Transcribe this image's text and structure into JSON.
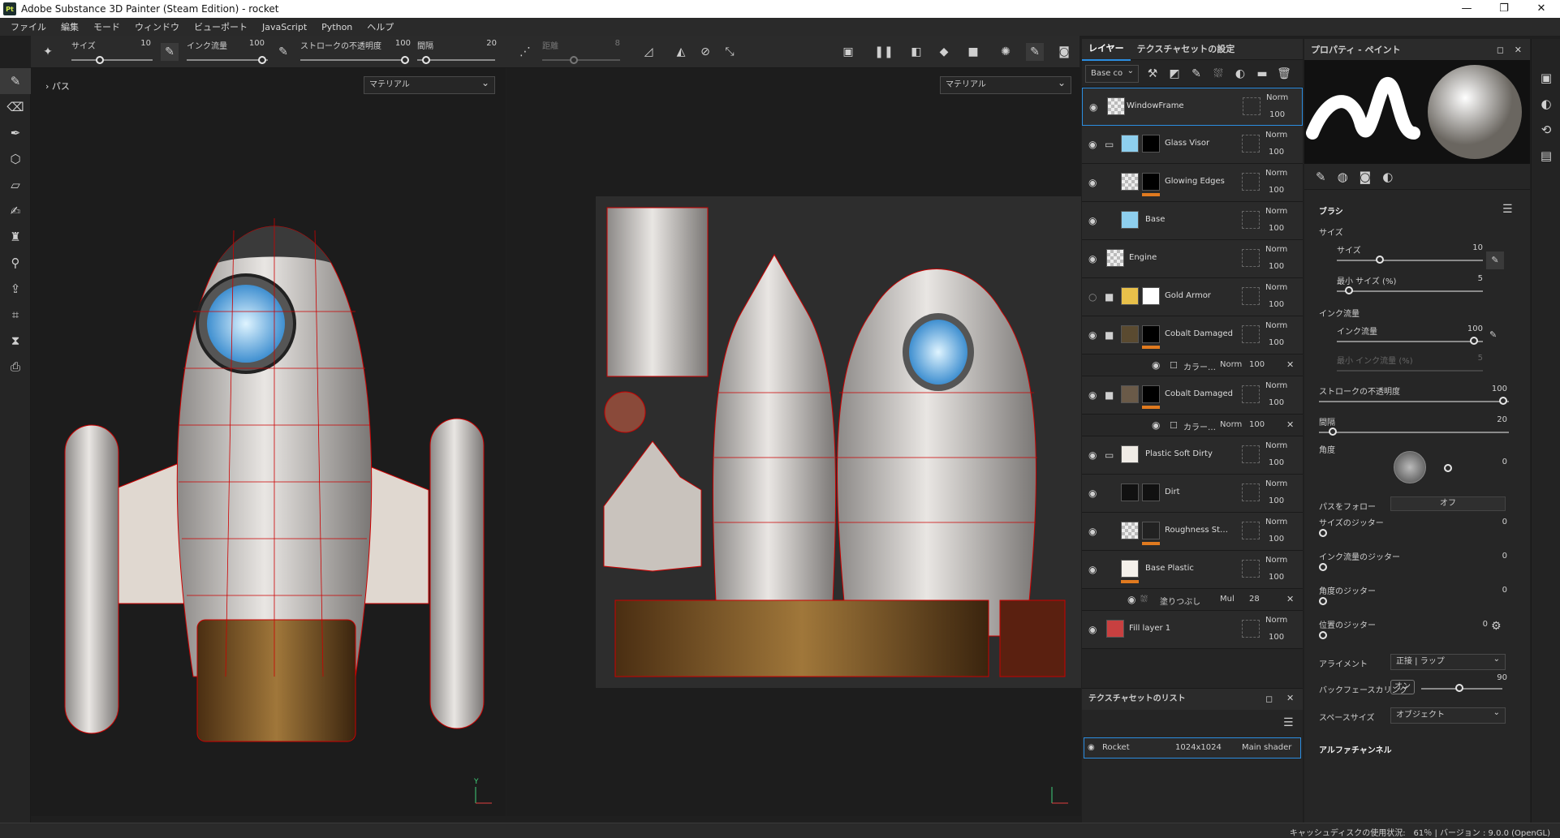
{
  "window": {
    "title": "Adobe Substance 3D Painter (Steam Edition) - rocket",
    "logo": "Pt",
    "controls": [
      "—",
      "❐",
      "✕"
    ]
  },
  "menu": [
    "ファイル",
    "編集",
    "モード",
    "ウィンドウ",
    "ビューポート",
    "JavaScript",
    "Python",
    "ヘルプ"
  ],
  "toolbar": {
    "size_label": "サイズ",
    "size_value": "10",
    "flow_label": "インク流量",
    "flow_value": "100",
    "opacity_label": "ストロークの不透明度",
    "opacity_value": "100",
    "spacing_label": "間隔",
    "spacing_value": "20",
    "distance_label": "距離",
    "distance_value": "8"
  },
  "viewport3d": {
    "path_label": "パス",
    "channel": "マテリアル"
  },
  "viewport2d": {
    "channel": "マテリアル"
  },
  "layers_panel": {
    "tab_layers": "レイヤー",
    "tab_texset": "テクスチャセットの設定",
    "channel_select": "Base co",
    "layers": [
      {
        "name": "WindowFrame",
        "blend": "Norm",
        "opacity": "100",
        "selected": true,
        "folder": false,
        "thumb": "chk",
        "mask": ""
      },
      {
        "name": "Glass Visor",
        "blend": "Norm",
        "opacity": "100",
        "folder": true,
        "thumb": "#8ecfee",
        "mask": "#000"
      },
      {
        "name": "Glowing Edges",
        "blend": "Norm",
        "opacity": "100",
        "folder": false,
        "thumb": "chk",
        "mask": "#000"
      },
      {
        "name": "Base",
        "blend": "Norm",
        "opacity": "100",
        "folder": false,
        "thumb": "#8ecfee",
        "mask": ""
      },
      {
        "name": "Engine",
        "blend": "Norm",
        "opacity": "100",
        "folder": false,
        "thumb": "chk",
        "mask": ""
      },
      {
        "name": "Gold Armor",
        "blend": "Norm",
        "opacity": "100",
        "folder": true,
        "thumb": "#e8c04a",
        "mask": "#fff"
      },
      {
        "name": "Cobalt Damaged",
        "blend": "Norm",
        "opacity": "100",
        "folder": true,
        "thumb": "#5a4a30",
        "mask": "#000"
      },
      {
        "name": "Cobalt Damaged",
        "blend": "Norm",
        "opacity": "100",
        "folder": true,
        "thumb": "#6a5a48",
        "mask": "#000"
      },
      {
        "name": "Plastic Soft Dirty",
        "blend": "Norm",
        "opacity": "100",
        "folder": true,
        "thumb": "#f0ece6",
        "mask": ""
      },
      {
        "name": "Dirt",
        "blend": "Norm",
        "opacity": "100",
        "folder": false,
        "thumb": "#111",
        "mask": "#111"
      },
      {
        "name": "Roughness St…",
        "blend": "Norm",
        "opacity": "100",
        "folder": false,
        "thumb": "chk",
        "mask": "#222"
      },
      {
        "name": "Base Plastic",
        "blend": "Norm",
        "opacity": "100",
        "folder": false,
        "thumb": "#f4f0ea",
        "mask": ""
      },
      {
        "name": "Fill layer 1",
        "blend": "Norm",
        "opacity": "100",
        "folder": false,
        "thumb": "#c84040",
        "mask": ""
      }
    ],
    "sub1": {
      "name": "カラー…",
      "blend": "Norm",
      "opacity": "100"
    },
    "sub2": {
      "name": "カラー…",
      "blend": "Norm",
      "opacity": "100"
    },
    "sub3": {
      "name": "塗りつぶし",
      "blend": "Mul",
      "opacity": "28"
    }
  },
  "texset_list": {
    "title": "テクスチャセットのリスト",
    "name": "Rocket",
    "resolution": "1024x1024",
    "shader": "Main shader"
  },
  "properties": {
    "title": "プロパティ - ペイント",
    "section_brush": "ブラシ",
    "size_group": "サイズ",
    "size": "サイズ",
    "size_value": "10",
    "min_size": "最小 サイズ (%)",
    "min_size_value": "5",
    "flow_group": "インク流量",
    "flow": "インク流量",
    "flow_value": "100",
    "min_flow": "最小 インク流量 (%)",
    "min_flow_value": "5",
    "stroke_opacity": "ストロークの不透明度",
    "stroke_opacity_value": "100",
    "spacing": "間隔",
    "spacing_value": "20",
    "angle": "角度",
    "angle_value": "0",
    "follow_path": "パスをフォロー",
    "follow_path_value": "オフ",
    "size_jitter": "サイズのジッター",
    "size_jitter_value": "0",
    "flow_jitter": "インク流量のジッター",
    "flow_jitter_value": "0",
    "angle_jitter": "角度のジッター",
    "angle_jitter_value": "0",
    "pos_jitter": "位置のジッター",
    "pos_jitter_value": "0",
    "alignment": "アライメント",
    "alignment_value": "正接 | ラップ",
    "backface": "バックフェースカリング",
    "backface_toggle": "オン",
    "backface_value": "90",
    "space_size": "スペースサイズ",
    "space_size_value": "オブジェクト",
    "alpha": "アルファチャンネル"
  },
  "status": {
    "text": "キャッシュディスクの使用状況:　61％ | バージョン : 9.0.0 (OpenGL)"
  }
}
